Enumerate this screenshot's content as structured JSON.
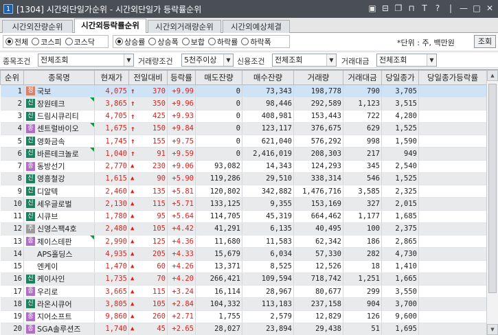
{
  "window": {
    "screen_no": "1",
    "title": "[1304] 시간외단일가순위 - 시간외단일가 등락률순위",
    "action_icons": [
      "▣",
      "⊟",
      "❐",
      "⊓",
      "T",
      "?",
      "|",
      "—",
      "□",
      "✕"
    ]
  },
  "tabs": [
    {
      "label": "시간외잔량순위",
      "active": false
    },
    {
      "label": "시간외등락률순위",
      "active": true
    },
    {
      "label": "시간외거래량순위",
      "active": false
    },
    {
      "label": "시간외예상체결",
      "active": false
    }
  ],
  "market_filter": {
    "options": [
      {
        "label": "전체",
        "selected": true
      },
      {
        "label": "코스피",
        "selected": false
      },
      {
        "label": "코스닥",
        "selected": false
      }
    ]
  },
  "sort_filter": {
    "options": [
      {
        "label": "상승률",
        "selected": true
      },
      {
        "label": "상승폭",
        "selected": false
      },
      {
        "label": "보합",
        "selected": false
      },
      {
        "label": "하락률",
        "selected": false
      },
      {
        "label": "하락폭",
        "selected": false
      }
    ]
  },
  "unit_note": "*단위 : 주, 백만원",
  "lookup_button": "조회",
  "conditions": {
    "stock_cond_label": "종목조건",
    "stock_cond_value": "전체조회",
    "volume_cond_label": "거래량조건",
    "volume_cond_value": "5천주이상",
    "credit_cond_label": "신용조건",
    "credit_cond_value": "전체조회",
    "amount_label": "거래대금",
    "amount_value": "전체조회"
  },
  "columns": [
    "순위",
    "종목명",
    "현재가",
    "전일대비",
    "등락률",
    "매도잔량",
    "매수잔량",
    "거래량",
    "거래대금",
    "당일종가",
    "당일종가등락률"
  ],
  "badge_colors": {
    "정": "#d9826a",
    "신": "#1f7f5e",
    "종": "#b06ec4",
    "주": "#9a9a9a"
  },
  "rows": [
    {
      "rank": "1",
      "badge": "정",
      "flag": false,
      "name": "국보",
      "price": "4,075",
      "dir": "upper",
      "change": "370",
      "rate": "+9.99",
      "sell": "0",
      "buy": "73,343",
      "volume": "198,778",
      "amount": "790",
      "close": "3,705",
      "close_rate": ""
    },
    {
      "rank": "2",
      "badge": "신",
      "flag": true,
      "name": "장원테크",
      "price": "3,865",
      "dir": "upper",
      "change": "350",
      "rate": "+9.96",
      "sell": "0",
      "buy": "98,446",
      "volume": "292,589",
      "amount": "1,123",
      "close": "3,515",
      "close_rate": ""
    },
    {
      "rank": "3",
      "badge": "신",
      "flag": false,
      "name": "드림시큐리티",
      "price": "4,705",
      "dir": "upper",
      "change": "425",
      "rate": "+9.93",
      "sell": "0",
      "buy": "408,981",
      "volume": "153,443",
      "amount": "722",
      "close": "4,280",
      "close_rate": ""
    },
    {
      "rank": "4",
      "badge": "종",
      "flag": true,
      "name": "센트럴바이오",
      "price": "1,675",
      "dir": "upper",
      "change": "150",
      "rate": "+9.84",
      "sell": "0",
      "buy": "123,117",
      "volume": "376,675",
      "amount": "629",
      "close": "1,525",
      "close_rate": ""
    },
    {
      "rank": "5",
      "badge": "신",
      "flag": false,
      "name": "영화금속",
      "price": "1,745",
      "dir": "upper",
      "change": "155",
      "rate": "+9.75",
      "sell": "0",
      "buy": "621,040",
      "volume": "576,292",
      "amount": "998",
      "close": "1,590",
      "close_rate": ""
    },
    {
      "rank": "6",
      "badge": "신",
      "flag": true,
      "name": "바른테크놀로",
      "price": "1,040",
      "dir": "upper",
      "change": "91",
      "rate": "+9.59",
      "sell": "0",
      "buy": "2,416,019",
      "volume": "208,303",
      "amount": "217",
      "close": "949",
      "close_rate": ""
    },
    {
      "rank": "7",
      "badge": "종",
      "flag": false,
      "name": "동방선기",
      "price": "2,770",
      "dir": "up",
      "change": "230",
      "rate": "+9.06",
      "sell": "93,082",
      "buy": "14,343",
      "volume": "124,293",
      "amount": "345",
      "close": "2,540",
      "close_rate": ""
    },
    {
      "rank": "8",
      "badge": "신",
      "flag": false,
      "name": "영흥철강",
      "price": "1,615",
      "dir": "up",
      "change": "90",
      "rate": "+5.90",
      "sell": "119,286",
      "buy": "29,510",
      "volume": "338,314",
      "amount": "546",
      "close": "1,525",
      "close_rate": ""
    },
    {
      "rank": "9",
      "badge": "신",
      "flag": false,
      "name": "디알텍",
      "price": "2,460",
      "dir": "up",
      "change": "135",
      "rate": "+5.81",
      "sell": "120,802",
      "buy": "342,882",
      "volume": "1,476,716",
      "amount": "3,585",
      "close": "2,325",
      "close_rate": ""
    },
    {
      "rank": "10",
      "badge": "신",
      "flag": false,
      "name": "세우글로벌",
      "price": "2,130",
      "dir": "up",
      "change": "115",
      "rate": "+5.71",
      "sell": "133,125",
      "buy": "9,355",
      "volume": "153,169",
      "amount": "327",
      "close": "2,015",
      "close_rate": ""
    },
    {
      "rank": "11",
      "badge": "신",
      "flag": false,
      "name": "시큐브",
      "price": "1,780",
      "dir": "up",
      "change": "95",
      "rate": "+5.64",
      "sell": "114,705",
      "buy": "45,319",
      "volume": "664,462",
      "amount": "1,177",
      "close": "1,685",
      "close_rate": ""
    },
    {
      "rank": "12",
      "badge": "주",
      "flag": false,
      "name": "신영스팩4호",
      "price": "2,480",
      "dir": "up",
      "change": "105",
      "rate": "+4.42",
      "sell": "41,291",
      "buy": "6,135",
      "volume": "40,495",
      "amount": "100",
      "close": "2,375",
      "close_rate": ""
    },
    {
      "rank": "13",
      "badge": "종",
      "flag": true,
      "name": "제이스테판",
      "price": "2,990",
      "dir": "up",
      "change": "125",
      "rate": "+4.36",
      "sell": "11,680",
      "buy": "11,583",
      "volume": "62,342",
      "amount": "186",
      "close": "2,865",
      "close_rate": ""
    },
    {
      "rank": "14",
      "badge": "",
      "flag": false,
      "name": "APS홀딩스",
      "price": "4,935",
      "dir": "up",
      "change": "205",
      "rate": "+4.33",
      "sell": "15,679",
      "buy": "6,034",
      "volume": "57,330",
      "amount": "282",
      "close": "4,730",
      "close_rate": ""
    },
    {
      "rank": "15",
      "badge": "",
      "flag": false,
      "name": "엔케이",
      "price": "1,470",
      "dir": "up",
      "change": "60",
      "rate": "+4.26",
      "sell": "13,371",
      "buy": "8,525",
      "volume": "12,526",
      "amount": "18",
      "close": "1,410",
      "close_rate": ""
    },
    {
      "rank": "16",
      "badge": "신",
      "flag": false,
      "name": "케이사인",
      "price": "1,735",
      "dir": "up",
      "change": "70",
      "rate": "+4.20",
      "sell": "266,421",
      "buy": "109,594",
      "volume": "718,742",
      "amount": "1,251",
      "close": "1,665",
      "close_rate": ""
    },
    {
      "rank": "17",
      "badge": "종",
      "flag": false,
      "name": "우리로",
      "price": "3,665",
      "dir": "up",
      "change": "115",
      "rate": "+3.24",
      "sell": "16,114",
      "buy": "28,967",
      "volume": "80,677",
      "amount": "299",
      "close": "3,550",
      "close_rate": ""
    },
    {
      "rank": "18",
      "badge": "신",
      "flag": false,
      "name": "라온시큐어",
      "price": "3,805",
      "dir": "up",
      "change": "105",
      "rate": "+2.84",
      "sell": "104,332",
      "buy": "113,183",
      "volume": "237,158",
      "amount": "904",
      "close": "3,700",
      "close_rate": ""
    },
    {
      "rank": "19",
      "badge": "종",
      "flag": false,
      "name": "지어소프트",
      "price": "9,860",
      "dir": "up",
      "change": "260",
      "rate": "+2.71",
      "sell": "1,755",
      "buy": "2,579",
      "volume": "12,829",
      "amount": "126",
      "close": "9,600",
      "close_rate": ""
    },
    {
      "rank": "20",
      "badge": "종",
      "flag": false,
      "name": "SGA솔루션즈",
      "price": "1,740",
      "dir": "up",
      "change": "45",
      "rate": "+2.65",
      "sell": "28,027",
      "buy": "23,894",
      "volume": "29,438",
      "amount": "51",
      "close": "1,695",
      "close_rate": ""
    }
  ]
}
